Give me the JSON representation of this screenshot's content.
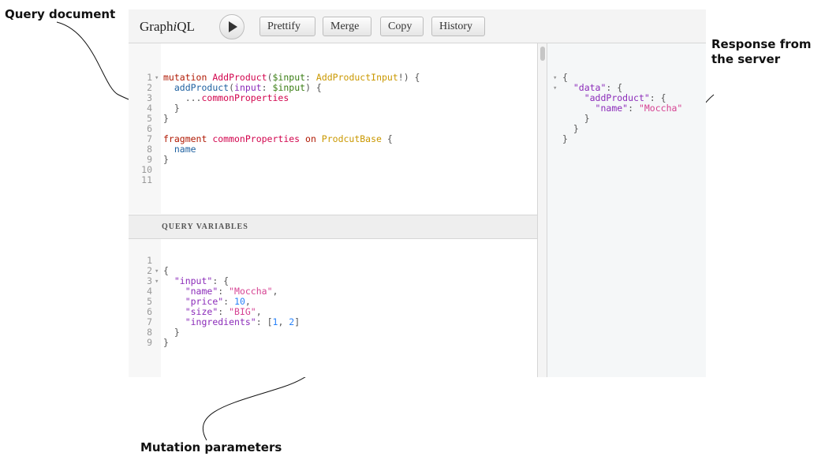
{
  "annotations": {
    "query_document": "Query document",
    "response_line1": "Response from",
    "response_line2": "the server",
    "mutation_parameters": "Mutation parameters"
  },
  "toolbar": {
    "brand_pre": "Graph",
    "brand_i": "i",
    "brand_post": "QL",
    "prettify": "Prettify",
    "merge": "Merge",
    "copy": "Copy",
    "history": "History"
  },
  "variables_header": "QUERY VARIABLES",
  "query_lines": [
    [
      [
        "kw",
        "mutation "
      ],
      [
        "def",
        "AddProduct"
      ],
      [
        "punc",
        "("
      ],
      [
        "var",
        "$input"
      ],
      [
        "punc",
        ": "
      ],
      [
        "type",
        "AddProductInput"
      ],
      [
        "punc",
        "!) {"
      ]
    ],
    [
      [
        "plain",
        "  "
      ],
      [
        "prop",
        "addProduct"
      ],
      [
        "punc",
        "("
      ],
      [
        "attr",
        "input"
      ],
      [
        "punc",
        ": "
      ],
      [
        "var",
        "$input"
      ],
      [
        "punc",
        ") {"
      ]
    ],
    [
      [
        "plain",
        "    "
      ],
      [
        "punc",
        "..."
      ],
      [
        "def",
        "commonProperties"
      ]
    ],
    [
      [
        "punc",
        "  }"
      ]
    ],
    [
      [
        "punc",
        "}"
      ]
    ],
    [],
    [
      [
        "kw",
        "fragment "
      ],
      [
        "def",
        "commonProperties "
      ],
      [
        "kw",
        "on "
      ],
      [
        "type",
        "ProdcutBase"
      ],
      [
        "punc",
        " {"
      ]
    ],
    [
      [
        "plain",
        "  "
      ],
      [
        "prop",
        "name"
      ]
    ],
    [
      [
        "punc",
        "}"
      ]
    ],
    [],
    []
  ],
  "query_folds": [
    1,
    0,
    0,
    0,
    0,
    0,
    0,
    0,
    0,
    0,
    0
  ],
  "variables_lines": [
    [],
    [
      [
        "punc",
        "{"
      ]
    ],
    [
      [
        "plain",
        "  "
      ],
      [
        "attr",
        "\"input\""
      ],
      [
        "punc",
        ": {"
      ]
    ],
    [
      [
        "plain",
        "    "
      ],
      [
        "attr",
        "\"name\""
      ],
      [
        "punc",
        ": "
      ],
      [
        "str",
        "\"Moccha\""
      ],
      [
        "punc",
        ","
      ]
    ],
    [
      [
        "plain",
        "    "
      ],
      [
        "attr",
        "\"price\""
      ],
      [
        "punc",
        ": "
      ],
      [
        "num",
        "10"
      ],
      [
        "punc",
        ","
      ]
    ],
    [
      [
        "plain",
        "    "
      ],
      [
        "attr",
        "\"size\""
      ],
      [
        "punc",
        ": "
      ],
      [
        "str",
        "\"BIG\""
      ],
      [
        "punc",
        ","
      ]
    ],
    [
      [
        "plain",
        "    "
      ],
      [
        "attr",
        "\"ingredients\""
      ],
      [
        "punc",
        ": ["
      ],
      [
        "num",
        "1"
      ],
      [
        "punc",
        ", "
      ],
      [
        "num",
        "2"
      ],
      [
        "punc",
        "]"
      ]
    ],
    [
      [
        "punc",
        "  }"
      ]
    ],
    [
      [
        "punc",
        "}"
      ]
    ]
  ],
  "variables_folds": [
    0,
    1,
    1,
    0,
    0,
    0,
    0,
    0,
    0
  ],
  "result_lines": [
    [
      [
        "punc",
        "{"
      ]
    ],
    [
      [
        "plain",
        "  "
      ],
      [
        "attr",
        "\"data\""
      ],
      [
        "punc",
        ": {"
      ]
    ],
    [
      [
        "plain",
        "    "
      ],
      [
        "attr",
        "\"addProduct\""
      ],
      [
        "punc",
        ": {"
      ]
    ],
    [
      [
        "plain",
        "      "
      ],
      [
        "attr",
        "\"name\""
      ],
      [
        "punc",
        ": "
      ],
      [
        "str",
        "\"Moccha\""
      ]
    ],
    [
      [
        "punc",
        "    }"
      ]
    ],
    [
      [
        "punc",
        "  }"
      ]
    ],
    [
      [
        "punc",
        "}"
      ]
    ]
  ],
  "result_folds": [
    1,
    1,
    0,
    0,
    0,
    0,
    0
  ],
  "colors": {
    "keyword": "#b11a04",
    "definition": "#d2054e",
    "property": "#1f61a0",
    "variable": "#397d13",
    "type": "#ca9800",
    "string": "#d64292",
    "number": "#2882f9",
    "attribute": "#8b2bb9"
  }
}
